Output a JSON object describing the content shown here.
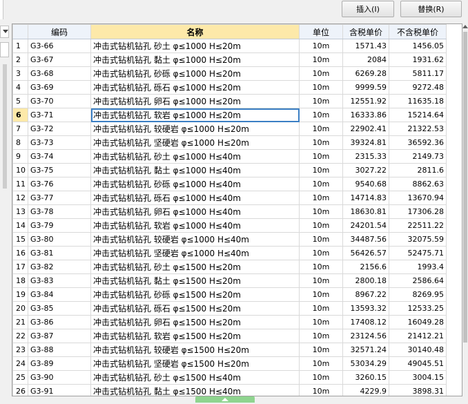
{
  "toolbar": {
    "insert_label": "插入(I)",
    "replace_label": "替换(R)"
  },
  "table": {
    "columns": [
      "",
      "编码",
      "名称",
      "单位",
      "含税单价",
      "不含税单价"
    ],
    "selected_row_index": 5,
    "rows": [
      {
        "rn": "1",
        "code": "G3-66",
        "name": "冲击式钻机钻孔 砂土 φ≤1000 H≤20m",
        "unit": "10m",
        "tax": "1571.43",
        "notax": "1456.05"
      },
      {
        "rn": "2",
        "code": "G3-67",
        "name": "冲击式钻机钻孔 黏土 φ≤1000 H≤20m",
        "unit": "10m",
        "tax": "2084",
        "notax": "1931.62"
      },
      {
        "rn": "3",
        "code": "G3-68",
        "name": "冲击式钻机钻孔 砂砾 φ≤1000 H≤20m",
        "unit": "10m",
        "tax": "6269.28",
        "notax": "5811.17"
      },
      {
        "rn": "4",
        "code": "G3-69",
        "name": "冲击式钻机钻孔 砾石 φ≤1000 H≤20m",
        "unit": "10m",
        "tax": "9999.59",
        "notax": "9272.48"
      },
      {
        "rn": "5",
        "code": "G3-70",
        "name": "冲击式钻机钻孔 卵石 φ≤1000 H≤20m",
        "unit": "10m",
        "tax": "12551.92",
        "notax": "11635.18"
      },
      {
        "rn": "6",
        "code": "G3-71",
        "name": "冲击式钻机钻孔 软岩 φ≤1000 H≤20m",
        "unit": "10m",
        "tax": "16333.86",
        "notax": "15214.64"
      },
      {
        "rn": "7",
        "code": "G3-72",
        "name": "冲击式钻机钻孔 较硬岩 φ≤1000 H≤20m",
        "unit": "10m",
        "tax": "22902.41",
        "notax": "21322.53"
      },
      {
        "rn": "8",
        "code": "G3-73",
        "name": "冲击式钻机钻孔 坚硬岩 φ≤1000 H≤20m",
        "unit": "10m",
        "tax": "39324.81",
        "notax": "36592.36"
      },
      {
        "rn": "9",
        "code": "G3-74",
        "name": "冲击式钻机钻孔 砂土 φ≤1000 H≤40m",
        "unit": "10m",
        "tax": "2315.33",
        "notax": "2149.73"
      },
      {
        "rn": "10",
        "code": "G3-75",
        "name": "冲击式钻机钻孔 黏土 φ≤1000 H≤40m",
        "unit": "10m",
        "tax": "3027.22",
        "notax": "2811.6"
      },
      {
        "rn": "11",
        "code": "G3-76",
        "name": "冲击式钻机钻孔 砂砾 φ≤1000 H≤40m",
        "unit": "10m",
        "tax": "9540.68",
        "notax": "8862.63"
      },
      {
        "rn": "12",
        "code": "G3-77",
        "name": "冲击式钻机钻孔 砾石 φ≤1000 H≤40m",
        "unit": "10m",
        "tax": "14714.83",
        "notax": "13670.94"
      },
      {
        "rn": "13",
        "code": "G3-78",
        "name": "冲击式钻机钻孔 卵石 φ≤1000 H≤40m",
        "unit": "10m",
        "tax": "18630.81",
        "notax": "17306.28"
      },
      {
        "rn": "14",
        "code": "G3-79",
        "name": "冲击式钻机钻孔 软岩 φ≤1000 H≤40m",
        "unit": "10m",
        "tax": "24201.54",
        "notax": "22511.22"
      },
      {
        "rn": "15",
        "code": "G3-80",
        "name": "冲击式钻机钻孔 较硬岩 φ≤1000 H≤40m",
        "unit": "10m",
        "tax": "34487.56",
        "notax": "32075.59"
      },
      {
        "rn": "16",
        "code": "G3-81",
        "name": "冲击式钻机钻孔 坚硬岩 φ≤1000 H≤40m",
        "unit": "10m",
        "tax": "56426.57",
        "notax": "52475.71"
      },
      {
        "rn": "17",
        "code": "G3-82",
        "name": "冲击式钻机钻孔 砂土 φ≤1500 H≤20m",
        "unit": "10m",
        "tax": "2156.6",
        "notax": "1993.4"
      },
      {
        "rn": "18",
        "code": "G3-83",
        "name": "冲击式钻机钻孔 黏土 φ≤1500 H≤20m",
        "unit": "10m",
        "tax": "2800.18",
        "notax": "2586.64"
      },
      {
        "rn": "19",
        "code": "G3-84",
        "name": "冲击式钻机钻孔 砂砾 φ≤1500 H≤20m",
        "unit": "10m",
        "tax": "8967.22",
        "notax": "8269.95"
      },
      {
        "rn": "20",
        "code": "G3-85",
        "name": "冲击式钻机钻孔 砾石 φ≤1500 H≤20m",
        "unit": "10m",
        "tax": "13593.32",
        "notax": "12533.25"
      },
      {
        "rn": "21",
        "code": "G3-86",
        "name": "冲击式钻机钻孔 卵石 φ≤1500 H≤20m",
        "unit": "10m",
        "tax": "17408.12",
        "notax": "16049.28"
      },
      {
        "rn": "22",
        "code": "G3-87",
        "name": "冲击式钻机钻孔 软岩 φ≤1500 H≤20m",
        "unit": "10m",
        "tax": "23124.56",
        "notax": "21412.21"
      },
      {
        "rn": "23",
        "code": "G3-88",
        "name": "冲击式钻机钻孔 较硬岩 φ≤1500 H≤20m",
        "unit": "10m",
        "tax": "32571.24",
        "notax": "30140.48"
      },
      {
        "rn": "24",
        "code": "G3-89",
        "name": "冲击式钻机钻孔 坚硬岩 φ≤1500 H≤20m",
        "unit": "10m",
        "tax": "53034.29",
        "notax": "49045.51"
      },
      {
        "rn": "25",
        "code": "G3-90",
        "name": "冲击式钻机钻孔 砂土 φ≤1500 H≤40m",
        "unit": "10m",
        "tax": "3260.15",
        "notax": "3004.15"
      },
      {
        "rn": "26",
        "code": "G3-91",
        "name": "冲击式钻机钻孔 黏土 φ≤1500 H≤40m",
        "unit": "10m",
        "tax": "4229.9",
        "notax": "3898.31"
      }
    ]
  }
}
